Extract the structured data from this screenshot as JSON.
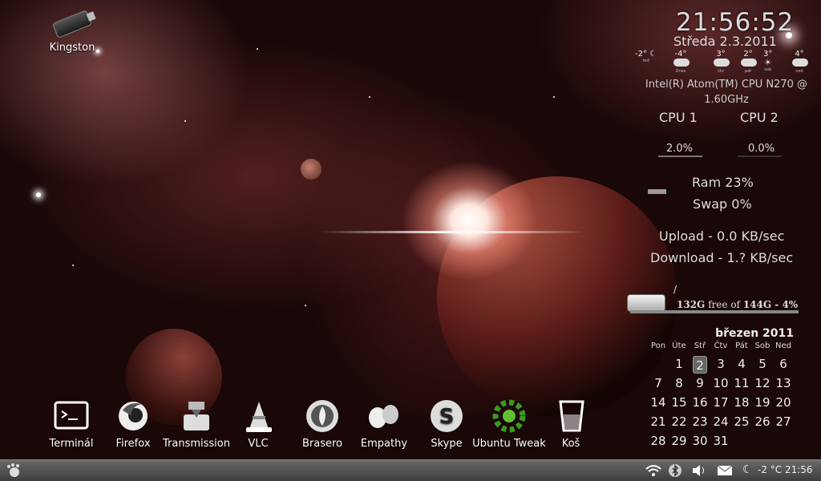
{
  "desktop": {
    "usb_label": "Kingston"
  },
  "conky": {
    "time": "21:56:52",
    "date": "Středa 2.3.2011",
    "weather": [
      {
        "temp": "-2°",
        "day": "teď",
        "icon": "moon-icon"
      },
      {
        "temp": "-4°",
        "day": "Dnes",
        "icon": "cloud-icon"
      },
      {
        "temp": "3°",
        "day": "čtv",
        "icon": "cloud-icon"
      },
      {
        "temp": "2°",
        "day": "pát",
        "icon": "cloud-icon"
      },
      {
        "temp": "3°",
        "day": "sob",
        "icon": "sun-cloud-icon"
      },
      {
        "temp": "4°",
        "day": "ned",
        "icon": "cloud-icon"
      }
    ],
    "cpu_name": "Intel(R) Atom(TM) CPU N270   @ 1.60GHz",
    "cpu1_label": "CPU 1",
    "cpu2_label": "CPU 2",
    "cpu1_value": "2.0%",
    "cpu2_value": "0.0%",
    "ram": "Ram 23%",
    "swap": "Swap 0%",
    "upload": "Upload - 0.0 KB/sec",
    "download": "Download - 1.? KB/sec",
    "disk_mount": "/",
    "disk_free": "132G",
    "disk_free_of": "free of",
    "disk_total": "144G - 4%",
    "ram_fraction": 0.23,
    "disk_used_fraction": 0.04
  },
  "calendar": {
    "month": "březen 2011",
    "headers": [
      "Pon",
      "Úte",
      "Stř",
      "Čtv",
      "Pát",
      "Sob",
      "Ned"
    ],
    "leading_blank": 1,
    "days": [
      "1",
      "2",
      "3",
      "4",
      "5",
      "6",
      "7",
      "8",
      "9",
      "10",
      "11",
      "12",
      "13",
      "14",
      "15",
      "16",
      "17",
      "18",
      "19",
      "20",
      "21",
      "22",
      "23",
      "24",
      "25",
      "26",
      "27",
      "28",
      "29",
      "30",
      "31"
    ],
    "today": "2"
  },
  "dock": [
    {
      "label": "Terminál",
      "icon": "terminal-icon"
    },
    {
      "label": "Firefox",
      "icon": "firefox-icon"
    },
    {
      "label": "Transmission",
      "icon": "transmission-icon"
    },
    {
      "label": "VLC",
      "icon": "vlc-cone-icon"
    },
    {
      "label": "Brasero",
      "icon": "brasero-icon"
    },
    {
      "label": "Empathy",
      "icon": "empathy-icon"
    },
    {
      "label": "Skype",
      "icon": "skype-icon"
    },
    {
      "label": "Ubuntu Tweak",
      "icon": "ubuntu-tweak-icon"
    },
    {
      "label": "Koš",
      "icon": "trash-icon"
    }
  ],
  "panel": {
    "clock": "-2 °C 21:56",
    "accent": "#3c3c3c"
  }
}
